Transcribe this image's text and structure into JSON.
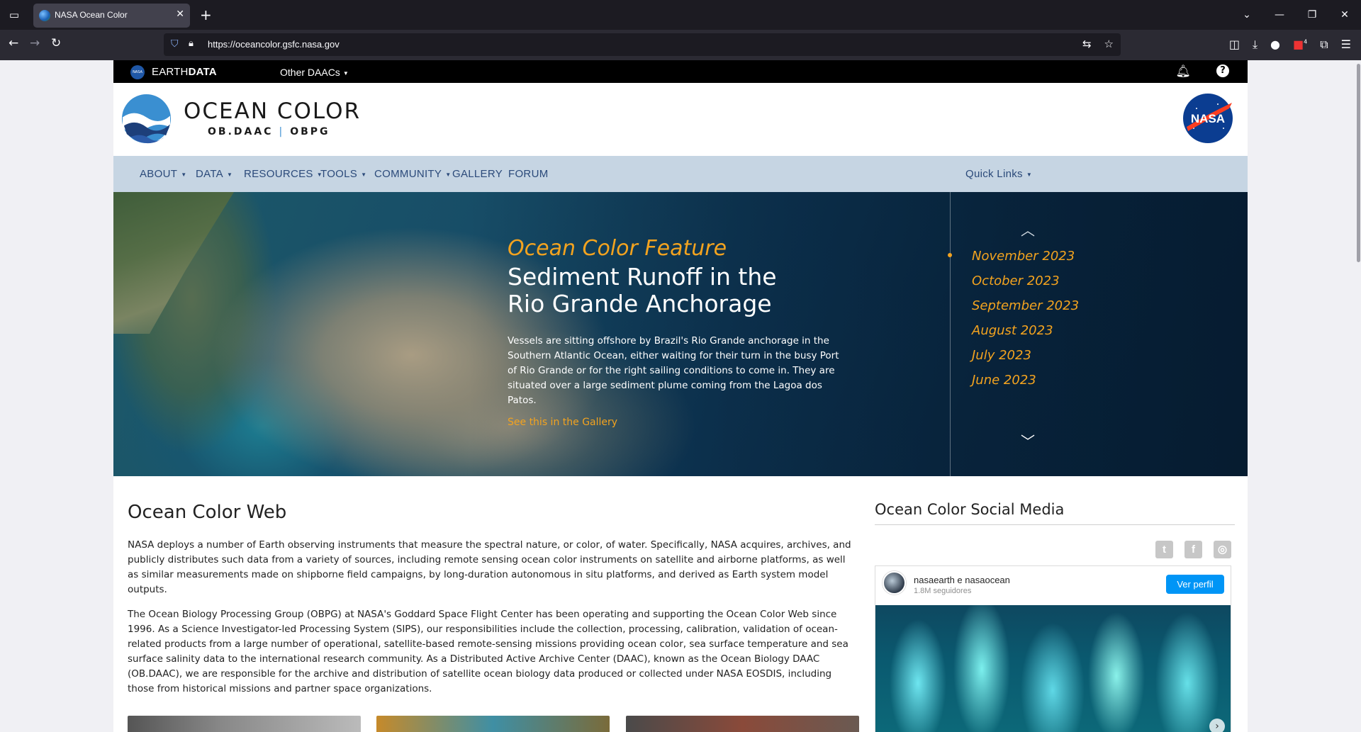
{
  "browser": {
    "tab_title": "NASA Ocean Color",
    "url": "https://oceancolor.gsfc.nasa.gov",
    "extension_badge": "4"
  },
  "earthdata_bar": {
    "brand_prefix": "EARTH",
    "brand_bold": "DATA",
    "other_daacs": "Other DAACs",
    "nasa_small": "NASA"
  },
  "header": {
    "title": "OCEAN COLOR",
    "sub_left": "OB.DAAC",
    "sub_sep": "|",
    "sub_right": "OBPG",
    "nasa_logo_text": "NASA"
  },
  "main_nav": {
    "items": [
      {
        "label": "ABOUT",
        "dropdown": true
      },
      {
        "label": "DATA",
        "dropdown": true
      },
      {
        "label": "RESOURCES",
        "dropdown": true
      },
      {
        "label": "TOOLS",
        "dropdown": true
      },
      {
        "label": "COMMUNITY",
        "dropdown": true
      },
      {
        "label": "GALLERY",
        "dropdown": false
      },
      {
        "label": "FORUM",
        "dropdown": false
      }
    ],
    "quick_links": "Quick Links"
  },
  "hero": {
    "eyebrow": "Ocean Color Feature",
    "title_line1": "Sediment Runoff in the",
    "title_line2": "Rio Grande Anchorage",
    "description": "Vessels are sitting offshore by Brazil's Rio Grande anchorage in the Southern Atlantic Ocean, either waiting for their turn in the busy Port of Rio Grande or for the right sailing conditions to come in. They are situated over a large sediment plume coming from the Lagoa dos Patos.",
    "link": "See this in the Gallery",
    "months": [
      "November 2023",
      "October 2023",
      "September 2023",
      "August 2023",
      "July 2023",
      "June 2023"
    ]
  },
  "ocean_color_web": {
    "title": "Ocean Color Web",
    "paragraph1": "NASA deploys a number of Earth observing instruments that measure the spectral nature, or color, of water. Specifically, NASA acquires, archives, and publicly distributes such data from a variety of sources, including remote sensing ocean color instruments on satellite and airborne platforms, as well as similar measurements made on shipborne field campaigns, by long-duration autonomous in situ platforms, and derived as Earth system model outputs.",
    "paragraph2": "The Ocean Biology Processing Group (OBPG) at NASA's Goddard Space Flight Center has been operating and supporting the Ocean Color Web since 1996. As a Science Investigator-led Processing System (SIPS), our responsibilities include the collection, processing, calibration, validation of ocean-related products from a large number of operational, satellite-based remote-sensing missions providing ocean color, sea surface temperature and sea surface salinity data to the international research community. As a Distributed Active Archive Center (DAAC), known as the Ocean Biology DAAC (OB.DAAC), we are responsible for the archive and distribution of satellite ocean biology data produced or collected under NASA EOSDIS, including those from historical missions and partner space organizations."
  },
  "social": {
    "title": "Ocean Color Social Media",
    "icons": [
      "twitter-icon",
      "facebook-icon",
      "instagram-icon"
    ],
    "instagram": {
      "account": "nasaearth e nasaocean",
      "followers": "1.8M seguidores",
      "button": "Ver perfil"
    }
  },
  "colors": {
    "accent_orange": "#f3a31f",
    "nav_bg": "#c6d5e3",
    "nav_text": "#2b4a7a",
    "instagram_blue": "#0095f6"
  }
}
